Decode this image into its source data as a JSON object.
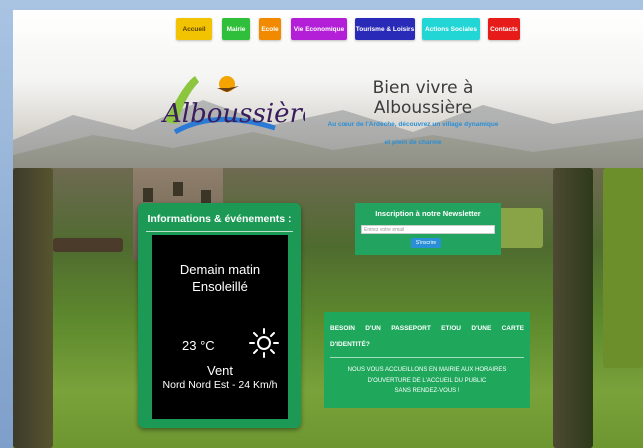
{
  "nav": {
    "items": [
      {
        "label": "Accueil",
        "color": "#f2c300"
      },
      {
        "label": "Mairie",
        "color": "#2fbf3a"
      },
      {
        "label": "Ecole",
        "color": "#f28a00"
      },
      {
        "label": "Vie Economique",
        "color": "#b21fd6"
      },
      {
        "label": "Tourisme & Loisirs",
        "color": "#2a2ab8"
      },
      {
        "label": "Actions Sociales",
        "color": "#22d6d6"
      },
      {
        "label": "Contacts",
        "color": "#e81b1b"
      }
    ]
  },
  "header": {
    "logo_text": "Alboussière",
    "tagline": "Bien vivre à Alboussière",
    "sub_line1": "Au cœur de l'Ardèche, découvrez un village dynamique",
    "sub_line2": "et plein de charme"
  },
  "info": {
    "title": "Informations & événements :",
    "weather": {
      "when": "Demain matin",
      "sky": "Ensoleillé",
      "temp": "23 °C",
      "icon": "sun-icon",
      "wind_label": "Vent",
      "wind_value": "Nord Nord Est - 24 Km/h"
    }
  },
  "newsletter": {
    "title": "Inscription à notre Newsletter",
    "placeholder": "Entrez votre email",
    "button": "S'inscrire"
  },
  "passport": {
    "title_line1": "BESOIN D'UN PASSEPORT ET/OU D'UNE CARTE",
    "title_line2": "D'IDENTITÉ?",
    "text_line1": "NOUS VOUS ACCUEILLONS EN MAIRIE AUX HORAIRES",
    "text_line2": "D'OUVERTURE DE L'ACCUEIL DU PUBLIC",
    "text_line3": "SANS RENDEZ-VOUS !"
  },
  "colors": {
    "green_panel": "#1c9a55",
    "accent_blue": "#2a8fd6"
  }
}
